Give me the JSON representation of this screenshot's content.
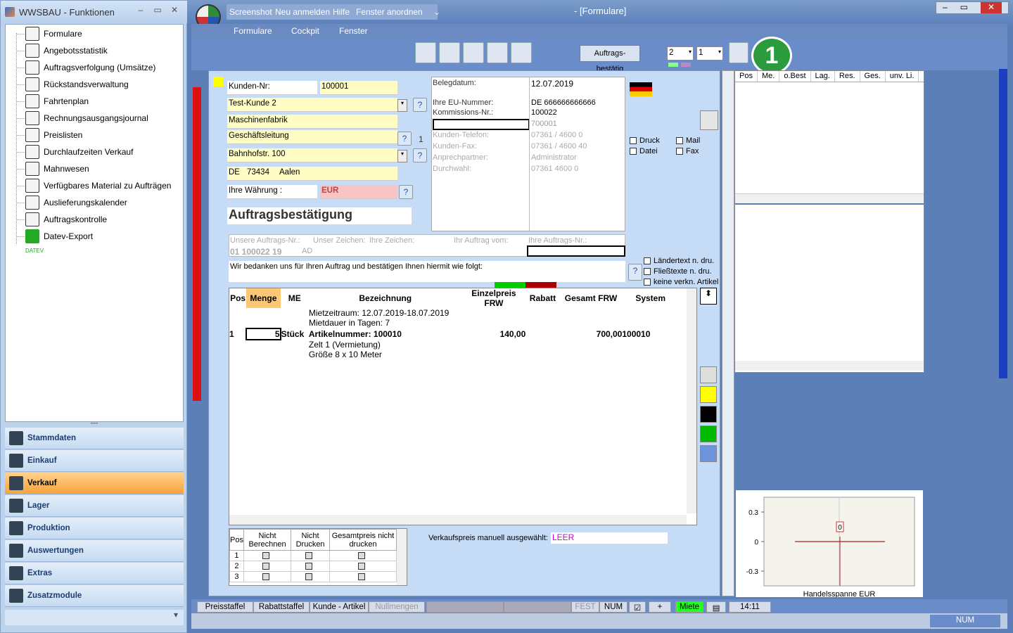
{
  "left_window": {
    "title": "WWSBAU - Funktionen",
    "tree_items": [
      "Formulare",
      "Angebotsstatistik",
      "Auftragsverfolgung (Umsätze)",
      "Rückstandsverwaltung",
      "Fahrtenplan",
      "Rechnungsausgangsjournal",
      "Preislisten",
      "Durchlaufzeiten Verkauf",
      "Mahnwesen",
      "Verfügbares Material zu Aufträgen",
      "Auslieferungskalender",
      "Auftragskontrolle",
      "Datev-Export"
    ],
    "datev_label": "DATEV",
    "nav": [
      "Stammdaten",
      "Einkauf",
      "Verkauf",
      "Lager",
      "Produktion",
      "Auswertungen",
      "Extras",
      "Zusatzmodule"
    ],
    "active_nav": "Verkauf"
  },
  "main_window": {
    "title": "- [Formulare]",
    "top_menu": [
      "Screenshot",
      "Neu anmelden",
      "Hilfe",
      "Fenster anordnen"
    ],
    "menubar": [
      "Formulare",
      "Cockpit",
      "Fenster"
    ],
    "auftrags_button": "Auftrags- bestätig",
    "copies_1": "2",
    "copies_2": "1",
    "badge": "1"
  },
  "form": {
    "kunden_nr_label": "Kunden-Nr:",
    "kunden_nr": "100001",
    "name1": "Test-Kunde 2",
    "name2": "Maschinenfabrik",
    "name3": "Geschäftsleitung",
    "name3_num": "1",
    "street": "Bahnhofstr. 100",
    "country": "DE",
    "zip": "73434",
    "city": "Aalen",
    "waehrung_label": "Ihre Währung :",
    "waehrung": "EUR",
    "doc_title": "Auftragsbestätigung",
    "belegdatum_label": "Belegdatum:",
    "belegdatum": "12.07.2019",
    "eu_label": "Ihre EU-Nummer:",
    "eu": "DE 666666666666",
    "kommission_label": "Kommissions-Nr.:",
    "kommission": "100022",
    "ref_value": "700001",
    "telefon_label": "Kunden-Telefon:",
    "telefon": "07361 / 4600 0",
    "fax_label": "Kunden-Fax:",
    "fax": "07361 / 4600 40",
    "ansprech_label": "Anprechpartner:",
    "ansprech": "Administrator",
    "durchwahl_label": "Durchwahl:",
    "durchwahl": "07361 4600 0",
    "cb_druck": "Druck",
    "cb_mail": "Mail",
    "cb_datei": "Datei",
    "cb_fax": "Fax",
    "ref_headers": [
      "Unsere Auftrags-Nr.:",
      "Unser Zeichen:",
      "Ihre Zeichen:",
      "Ihr Auftrag vom:",
      "Ihre Auftrags-Nr.:"
    ],
    "ref_values": [
      "01 100022 19",
      "AD",
      "",
      "",
      ""
    ],
    "intro_text": "Wir bedanken uns für Ihren Auftrag und bestätigen Ihnen hiermit wie folgt:",
    "options": [
      "Ländertext  n. dru.",
      "Fließtexte n. dru.",
      "keine verkn. Artikel"
    ],
    "columns": [
      "Pos",
      "Menge",
      "ME",
      "Bezeichnung",
      "Einzelpreis FRW",
      "Rabatt",
      "Gesamt FRW",
      "System"
    ],
    "rows": [
      [
        "",
        "",
        "",
        "Mietzeitraum: 12.07.2019-18.07.2019",
        "",
        "",
        "",
        ""
      ],
      [
        "",
        "",
        "",
        "Mietdauer in Tagen: 7",
        "",
        "",
        "",
        ""
      ],
      [
        "",
        "",
        "",
        "",
        "",
        "",
        "",
        ""
      ],
      [
        "1",
        "5",
        "Stück",
        "Artikelnummer: 100010",
        "140,00",
        "",
        "700,00",
        "100010"
      ],
      [
        "",
        "",
        "",
        "Zelt 1 (Vermietung)",
        "",
        "",
        "",
        ""
      ],
      [
        "",
        "",
        "",
        "Größe 8 x 10 Meter",
        "",
        "",
        "",
        ""
      ]
    ],
    "sub_columns": [
      "Pos",
      "Nicht Berechnen",
      "Nicht Drucken",
      "Gesamtpreis nicht drucken"
    ],
    "sub_rows": [
      "1",
      "2",
      "3"
    ],
    "vk_label": "Verkaufspreis manuell ausgewählt:",
    "vk_value": "LEER"
  },
  "right_panel": {
    "columns": [
      "Pos",
      "Me.",
      "o.Best",
      "Lag.",
      "Res.",
      "Ges.",
      "unv. Li."
    ]
  },
  "chart_data": {
    "type": "line",
    "title": "",
    "xlabel": "Handelsspanne EUR",
    "ylabel": "",
    "yticks": [
      "0.3",
      "0",
      "-0.3"
    ],
    "ylim": [
      -0.45,
      0.45
    ],
    "annotation": "0",
    "series": [
      {
        "values": [
          0,
          0
        ]
      }
    ]
  },
  "statusbar": [
    "Preisstaffel",
    "Rabattstaffel",
    "Kunde - Artikel",
    "Nullmengen",
    "FEST",
    "NUM",
    "Miete",
    "14:11"
  ],
  "bottom": {
    "num": "NUM"
  }
}
